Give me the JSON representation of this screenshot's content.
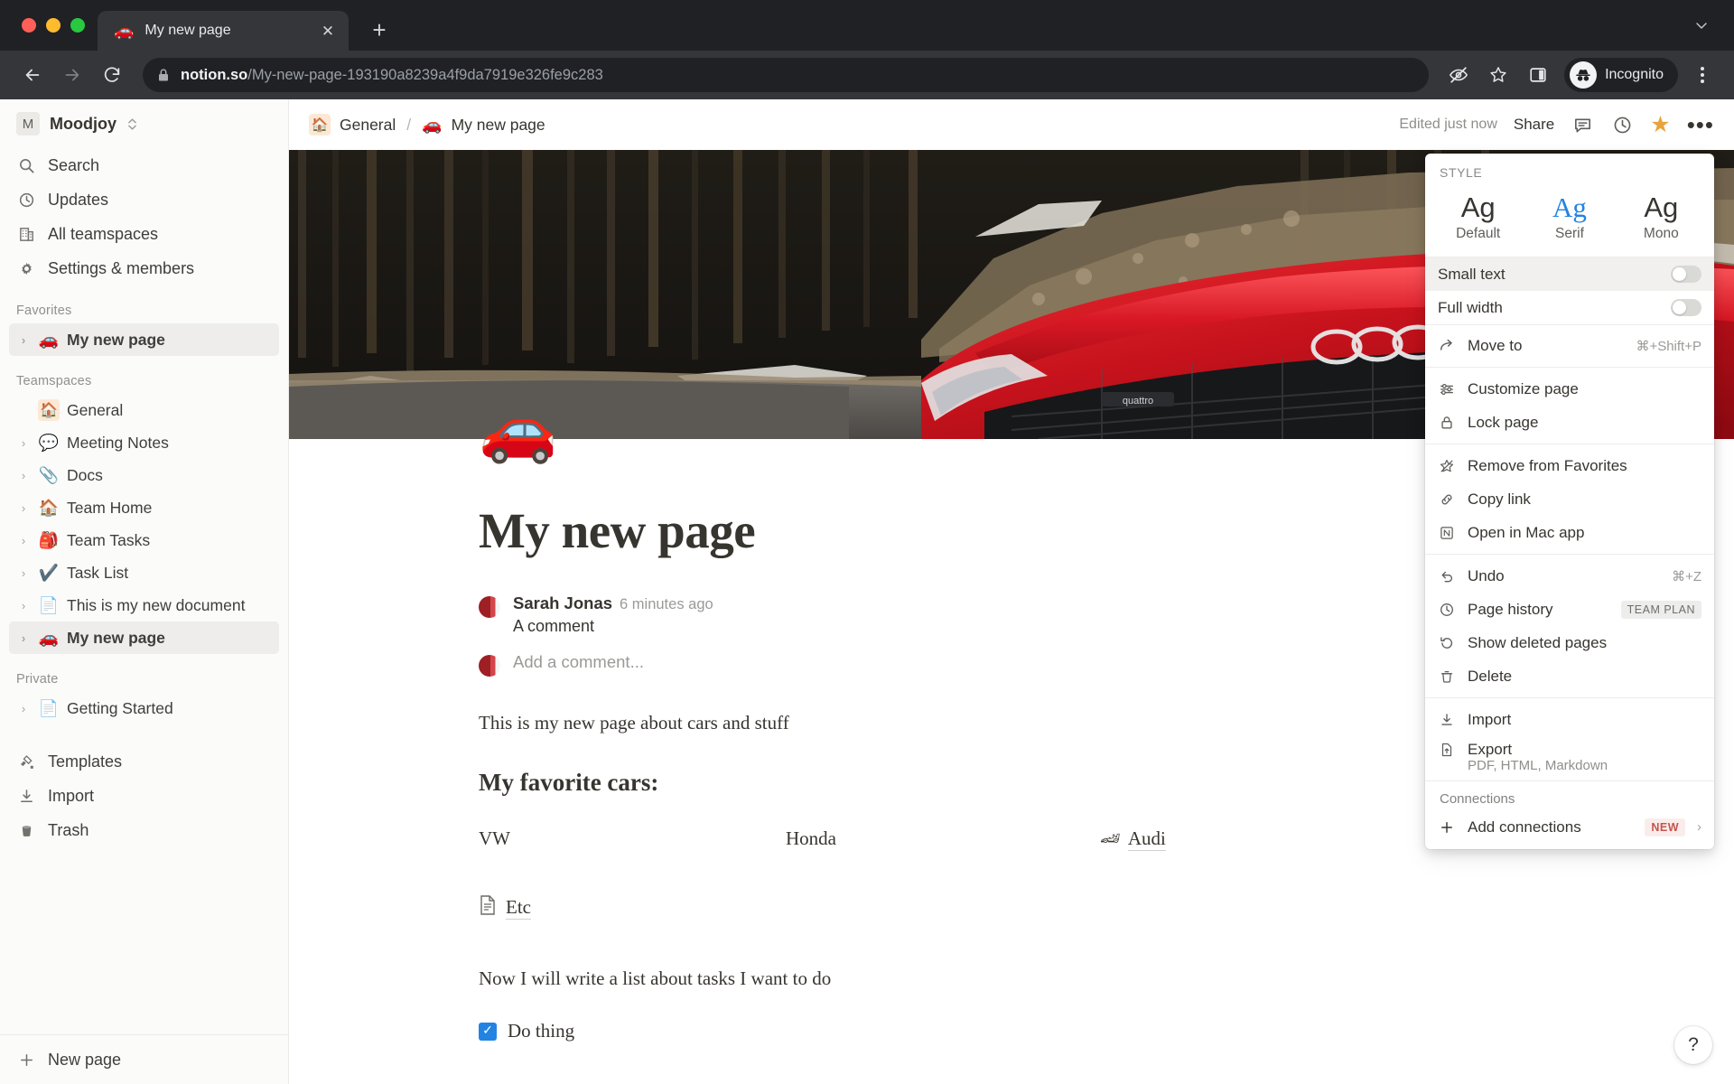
{
  "browser": {
    "tab": {
      "title": "My new page",
      "favicon": "red-car-emoji",
      "close_label": "✕"
    },
    "new_tab_label": "+",
    "tabstrip_menu_icon": "chevron-down-icon",
    "nav": {
      "back": "←",
      "forward": "→",
      "reload": "⟳"
    },
    "omnibox": {
      "lock_icon": "lock-icon",
      "host": "notion.so",
      "path": "/My-new-page-193190a8239a4f9da7919e326fe9c283"
    },
    "toolbar_icons": [
      "eye-off-icon",
      "star-icon",
      "side-panel-icon"
    ],
    "profile": {
      "label": "Incognito",
      "icon": "incognito-icon"
    },
    "menu_icon": "three-dots-vertical-icon"
  },
  "sidebar": {
    "workspace": {
      "badge": "M",
      "name": "Moodjoy",
      "caret": "⌃⌄"
    },
    "nav_items": [
      {
        "icon": "search-icon",
        "label": "Search"
      },
      {
        "icon": "clock-icon",
        "label": "Updates"
      },
      {
        "icon": "building-icon",
        "label": "All teamspaces"
      },
      {
        "icon": "gear-icon",
        "label": "Settings & members"
      }
    ],
    "favorites_label": "Favorites",
    "favorites": [
      {
        "emoji": "🚗",
        "label": "My new page",
        "active": true
      }
    ],
    "teamspaces_label": "Teamspaces",
    "teamspaces": [
      {
        "emoji": "🏠",
        "label": "General",
        "boxed": true,
        "no_chevron": true
      },
      {
        "emoji": "💬",
        "label": "Meeting Notes"
      },
      {
        "emoji": "📎",
        "label": "Docs"
      },
      {
        "emoji": "🏠",
        "label": "Team Home"
      },
      {
        "emoji": "🎒",
        "label": "Team Tasks"
      },
      {
        "emoji": "✔️",
        "label": "Task List"
      },
      {
        "emoji": "📄",
        "label": "This is my new document"
      },
      {
        "emoji": "🚗",
        "label": "My new page",
        "active": true
      }
    ],
    "private_label": "Private",
    "private": [
      {
        "emoji": "📄",
        "label": "Getting Started"
      }
    ],
    "bottom_links": [
      {
        "icon": "templates-icon",
        "label": "Templates"
      },
      {
        "icon": "import-icon",
        "label": "Import"
      },
      {
        "icon": "trash-icon",
        "label": "Trash"
      }
    ],
    "new_page": {
      "icon": "plus-icon",
      "label": "New page"
    }
  },
  "topbar": {
    "breadcrumb": {
      "parent_emoji": "🏠",
      "parent": "General",
      "separator": "/",
      "page_emoji": "🚗",
      "page": "My new page"
    },
    "edited": "Edited just now",
    "share": "Share",
    "icons": [
      "comment-icon",
      "history-icon",
      "star-icon",
      "more-icon"
    ]
  },
  "page": {
    "cover_alt": "red-audi-r8-on-forest-road",
    "emoji": "🚗",
    "title": "My new page",
    "comment": {
      "author": "Sarah Jonas",
      "time": "6 minutes ago",
      "body": "A comment",
      "placeholder": "Add a comment..."
    },
    "paragraph": "This is my new page about cars and stuff",
    "heading": "My favorite cars:",
    "columns": [
      {
        "label": "VW"
      },
      {
        "label": "Honda"
      },
      {
        "emoji": "🏎",
        "label": "Audi",
        "link": true
      }
    ],
    "etc": {
      "emoji": "📄",
      "label": "Etc",
      "link": true
    },
    "tasks_intro": "Now I will write a list about tasks I want to do",
    "todo": {
      "checked": true,
      "label": "Do thing"
    }
  },
  "menu": {
    "style_label": "STYLE",
    "styles": [
      {
        "sample": "Ag",
        "name": "Default",
        "selected": false
      },
      {
        "sample": "Ag",
        "name": "Serif",
        "selected": true
      },
      {
        "sample": "Ag",
        "name": "Mono",
        "selected": false
      }
    ],
    "toggles": [
      {
        "label": "Small text",
        "on": false,
        "highlighted": true
      },
      {
        "label": "Full width",
        "on": false,
        "highlighted": false
      }
    ],
    "move_to": {
      "icon": "arrow-forward-icon",
      "label": "Move to",
      "shortcut": "⌘+Shift+P"
    },
    "group_page": [
      {
        "icon": "sliders-icon",
        "label": "Customize page"
      },
      {
        "icon": "lock-icon",
        "label": "Lock page"
      }
    ],
    "group_actions": [
      {
        "icon": "star-off-icon",
        "label": "Remove from Favorites"
      },
      {
        "icon": "link-icon",
        "label": "Copy link"
      },
      {
        "icon": "notion-icon",
        "label": "Open in Mac app"
      }
    ],
    "group_history": [
      {
        "icon": "undo-icon",
        "label": "Undo",
        "shortcut": "⌘+Z"
      },
      {
        "icon": "clock-icon",
        "label": "Page history",
        "badge": "TEAM PLAN"
      },
      {
        "icon": "restore-icon",
        "label": "Show deleted pages"
      },
      {
        "icon": "trash-icon",
        "label": "Delete"
      }
    ],
    "group_io": [
      {
        "icon": "import-icon",
        "label": "Import"
      },
      {
        "icon": "export-icon",
        "label": "Export",
        "sub": "PDF, HTML, Markdown"
      }
    ],
    "connections_label": "Connections",
    "add_connections": {
      "icon": "plus-icon",
      "label": "Add connections",
      "badge": "NEW",
      "chevron": "›"
    }
  },
  "help_button": {
    "icon": "question-icon",
    "label": "?"
  },
  "colors": {
    "chrome_bg": "#202124",
    "toolbar_bg": "#35363a",
    "sidebar_bg": "#fbfbfa",
    "accent_blue": "#2383e2",
    "star_yellow": "#e9a33b",
    "text": "#37352f"
  }
}
